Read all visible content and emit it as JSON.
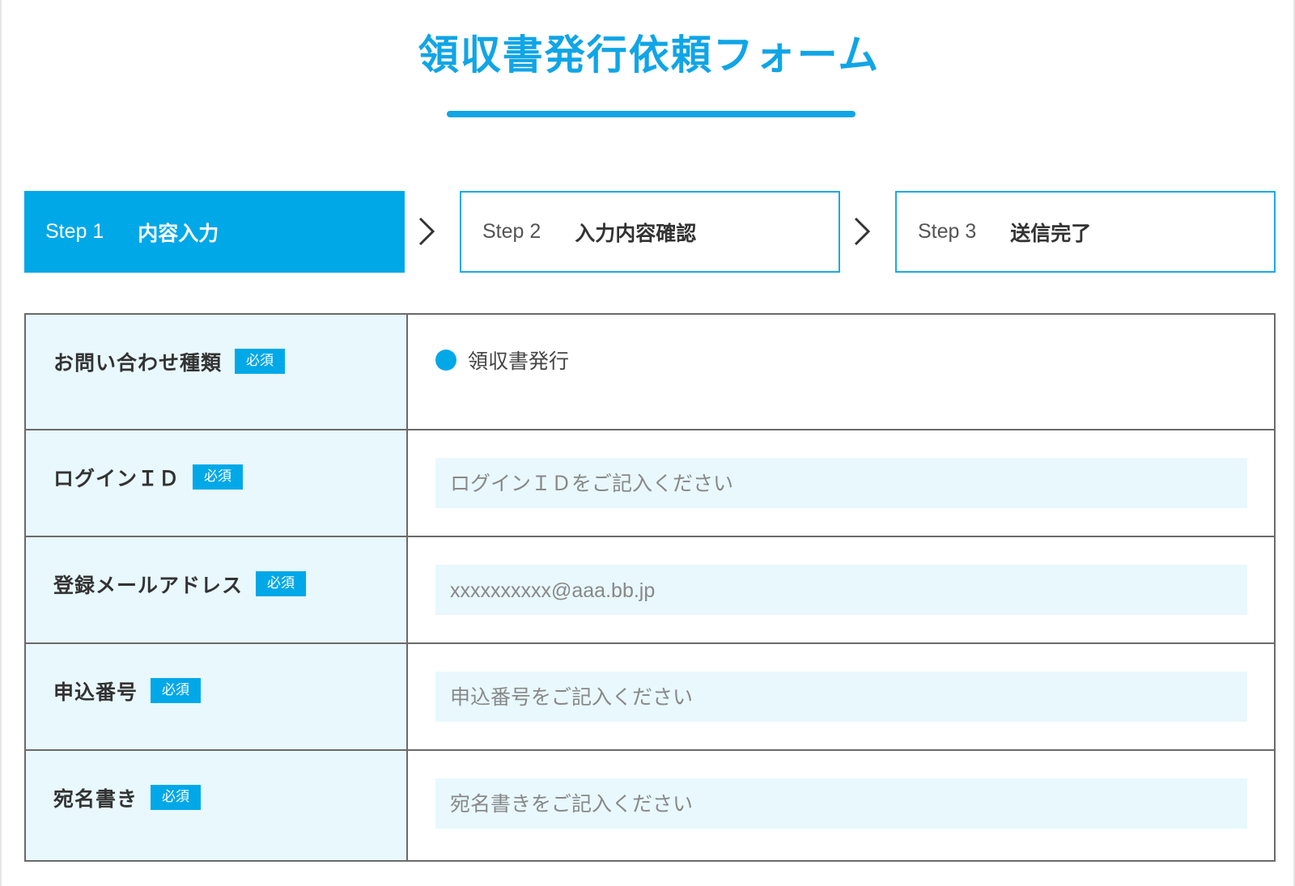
{
  "page_title": "領収書発行依頼フォーム",
  "steps": [
    {
      "number": "Step 1",
      "name": "内容入力",
      "active": true
    },
    {
      "number": "Step 2",
      "name": "入力内容確認",
      "active": false
    },
    {
      "number": "Step 3",
      "name": "送信完了",
      "active": false
    }
  ],
  "required_badge": "必須",
  "fields": {
    "inquiry_type": {
      "label": "お問い合わせ種類",
      "option": "領収書発行"
    },
    "login_id": {
      "label": "ログインＩＤ",
      "placeholder": "ログインＩＤをご記入ください"
    },
    "email": {
      "label": "登録メールアドレス",
      "placeholder": "xxxxxxxxxx@aaa.bb.jp"
    },
    "application_number": {
      "label": "申込番号",
      "placeholder": "申込番号をご記入ください"
    },
    "addressee": {
      "label": "宛名書き",
      "placeholder": "宛名書きをご記入ください"
    }
  },
  "colors": {
    "accent": "#00a8e8",
    "label_background": "#e8f8fd",
    "border": "#6a6a6a"
  },
  "icons": {
    "step_separator": "chevron-right-icon",
    "radio": "radio-selected-icon"
  }
}
